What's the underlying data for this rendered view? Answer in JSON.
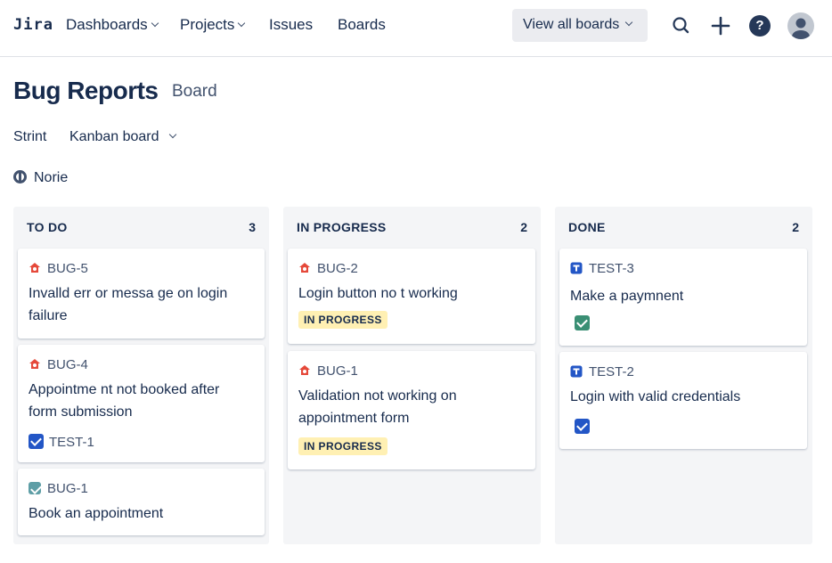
{
  "nav": {
    "logo": "Jira",
    "dashboards": "Dashboards",
    "projects": "Projects",
    "issues": "Issues",
    "boards": "Boards",
    "view_all_boards": "View all boards",
    "help_glyph": "?"
  },
  "page": {
    "title": "Bug Reports",
    "subtitle": "Board",
    "filter_label": "Strint",
    "filter_value": "Kanban board",
    "user_filter": "Norie"
  },
  "columns": [
    {
      "name": "TO DO",
      "count": "3"
    },
    {
      "name": "IN PROGRESS",
      "count": "2"
    },
    {
      "name": "DONE",
      "count": "2"
    }
  ],
  "cards": {
    "bug5": {
      "key": "BUG-5",
      "title": "Invalld err or messa ge on login failure"
    },
    "bug4": {
      "key": "BUG-4",
      "title": "Appointme nt not booked after form submission",
      "link": "TEST-1"
    },
    "bug1_todo": {
      "key": "BUG-1",
      "title": "Book an appointment"
    },
    "bug2": {
      "key": "BUG-2",
      "title": "Login button no t working",
      "status": "IN PROGRESS"
    },
    "bug1_prog": {
      "key": "BUG-1",
      "title": "Validation not working on appointment form",
      "status": "IN PROGRESS"
    },
    "test3": {
      "key": "TEST-3",
      "title": "Make a paymnent"
    },
    "test2": {
      "key": "TEST-2",
      "title": "Login with valid credentials"
    }
  },
  "colors": {
    "bug": "#e5493a",
    "task": "#2684ff",
    "done_check": "#36b37e",
    "todo_check": "#5e9ea6",
    "link_check": "#0052cc",
    "status_badge": "#fff0b3"
  },
  "icons": {
    "search": "search-icon",
    "create": "plus-icon",
    "help": "help-icon",
    "avatar": "user-avatar-icon",
    "bug": "bug-icon",
    "task": "task-icon"
  }
}
